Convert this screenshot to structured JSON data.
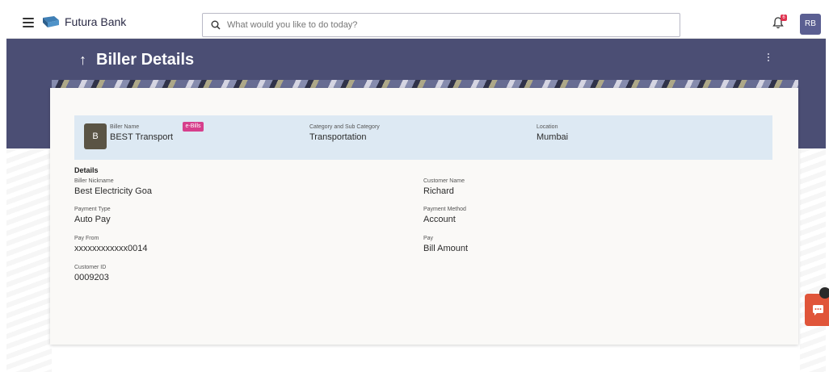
{
  "topbar": {
    "brand": "Futura Bank",
    "search_placeholder": "What would you like to do today?",
    "notification_count": "6",
    "user_initials": "RB"
  },
  "header": {
    "title": "Biller Details"
  },
  "biller": {
    "avatar_letter": "B",
    "name_label": "Biller Name",
    "name_value": "BEST Transport",
    "tag": "e-Bills",
    "category_label": "Category and Sub Category",
    "category_value": "Transportation",
    "location_label": "Location",
    "location_value": "Mumbai"
  },
  "details": {
    "heading": "Details",
    "fields": [
      {
        "label": "Biller Nickname",
        "value": "Best Electricity Goa"
      },
      {
        "label": "Customer Name",
        "value": "Richard"
      },
      {
        "label": "Payment Type",
        "value": "Auto Pay"
      },
      {
        "label": "Payment Method",
        "value": "Account"
      },
      {
        "label": "Pay From",
        "value": "xxxxxxxxxxxx0014"
      },
      {
        "label": "Pay",
        "value": "Bill Amount"
      },
      {
        "label": "Customer ID",
        "value": "0009203"
      }
    ]
  },
  "colors": {
    "header_band": "#4b4e74",
    "accent": "#5b5f92",
    "ebills_tag": "#d63f8c",
    "chat": "#e0553a"
  }
}
